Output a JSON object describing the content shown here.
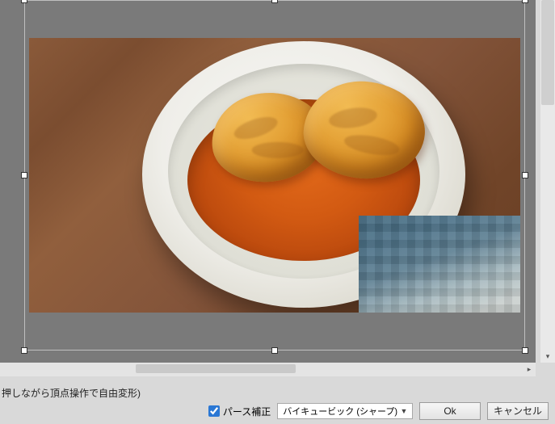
{
  "hint_text": "押しながら頂点操作で自由変形)",
  "checkbox": {
    "label": "パース補正",
    "checked": true
  },
  "interpolation": {
    "selected": "バイキュービック (シャープ)"
  },
  "buttons": {
    "ok": "Ok",
    "cancel": "キャンセル"
  },
  "image": {
    "subject": "stuffed-cabbage-rolls-in-tomato-sauce-on-white-plate",
    "background": "wooden-table",
    "overlay": "pixelated-region-bottom-right"
  },
  "transform_box": {
    "handles": [
      "nw",
      "n",
      "ne",
      "w",
      "e",
      "sw",
      "s",
      "se"
    ]
  }
}
